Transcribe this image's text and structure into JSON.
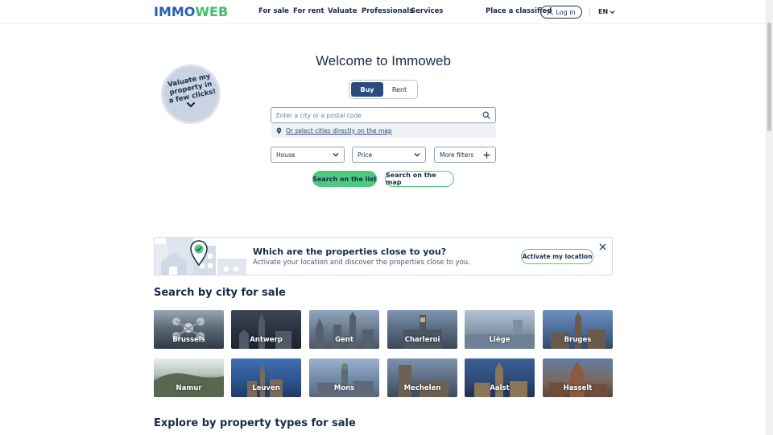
{
  "header": {
    "logo_part1": "IMMO",
    "logo_part2": "WEB",
    "nav": [
      "For sale",
      "For rent",
      "Valuate",
      "Professionals",
      "Services"
    ],
    "place_classified": "Place a classified",
    "login_label": "Log in",
    "language": "EN"
  },
  "valuate_badge": {
    "text": "Valuate my property in a few clicks!"
  },
  "hero": {
    "title": "Welcome to Immoweb",
    "toggle": {
      "buy": "Buy",
      "rent": "Rent",
      "selected": "Buy"
    },
    "search_placeholder": "Enter a city or a postal code",
    "map_link": "Or select cities directly on the map",
    "property_type": "House",
    "price": "Price",
    "more_filters": "More filters",
    "search_list": "Search on the list",
    "search_map": "Search on the map"
  },
  "location_banner": {
    "title": "Which are the properties close to you?",
    "subtitle": "Activate your location and discover the properties close to you.",
    "button": "Activate my location"
  },
  "cities_section": {
    "title": "Search by city for sale",
    "cities": [
      "Brussels",
      "Antwerp",
      "Gent",
      "Charleroi",
      "Liège",
      "Bruges",
      "Namur",
      "Leuven",
      "Mons",
      "Mechelen",
      "Aalst",
      "Hasselt"
    ]
  },
  "property_types_section": {
    "title": "Explore by property types for sale"
  },
  "colors": {
    "brand_blue": "#2a5fb0",
    "brand_green": "#3cbf6a",
    "navy": "#1b2a4a",
    "button_green": "#4bcb7d"
  }
}
